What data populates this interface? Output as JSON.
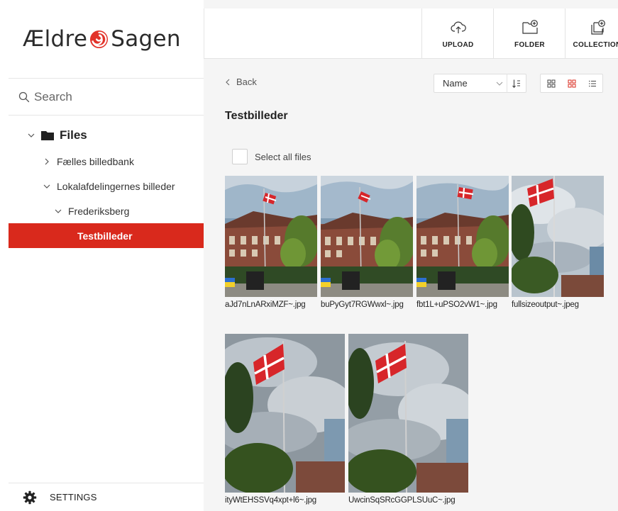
{
  "brand": {
    "name_left": "Ældre",
    "name_right": "Sagen",
    "accent": "#d9291c"
  },
  "sidebar": {
    "search_placeholder": "Search",
    "root_label": "Files",
    "items": [
      {
        "label": "Fælles billedbank",
        "expanded": false
      },
      {
        "label": "Lokalafdelingernes billeder",
        "expanded": true
      },
      {
        "label": "Frederiksberg",
        "expanded": true
      },
      {
        "label": "Testbilleder",
        "active": true
      }
    ],
    "settings_label": "SETTINGS"
  },
  "toolbar": {
    "upload_label": "UPLOAD",
    "folder_label": "FOLDER",
    "collection_label": "COLLECTION"
  },
  "content": {
    "back_label": "Back",
    "sort_value": "Name",
    "title": "Testbilleder",
    "select_all_label": "Select all files",
    "files": [
      {
        "name": "aJd7nLnARxiMZF~.jpg",
        "scene": "building-flag"
      },
      {
        "name": "buPyGyt7RGWwxl~.jpg",
        "scene": "building-flag"
      },
      {
        "name": "fbt1L+uPSO2vW1~.jpg",
        "scene": "building-flag"
      },
      {
        "name": "fullsizeoutput~.jpeg",
        "scene": "sky-flag"
      },
      {
        "name": "ityWtEHSSVq4xpt+l6~.jpg",
        "scene": "sky-flag"
      },
      {
        "name": "UwcinSqSRcGGPLSUuC~.jpg",
        "scene": "sky-flag"
      }
    ]
  }
}
